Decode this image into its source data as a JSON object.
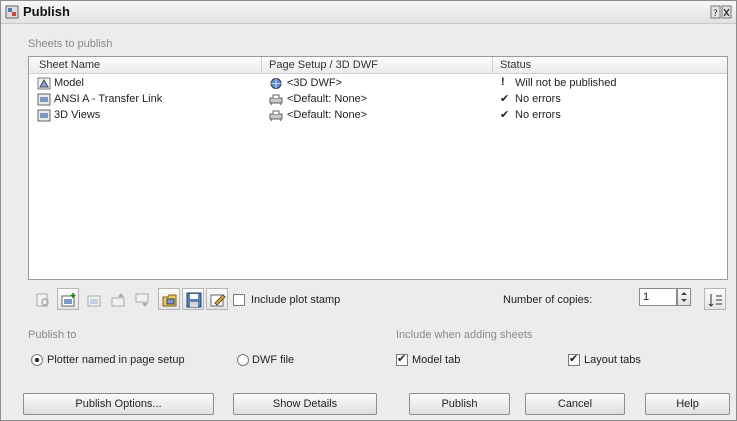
{
  "window": {
    "title": "Publish"
  },
  "sheets_group": {
    "label": "Sheets to publish"
  },
  "table": {
    "columns": [
      "Sheet Name",
      "Page Setup / 3D DWF",
      "Status"
    ],
    "rows": [
      {
        "sheet": "Model",
        "sheet_icon": "model-icon",
        "setup": "<3D DWF>",
        "setup_icon": "globe-icon",
        "status": "Will not be published",
        "status_icon": "exclamation-icon"
      },
      {
        "sheet": "ANSI A - Transfer Link",
        "sheet_icon": "layout-icon",
        "setup": "<Default: None>",
        "setup_icon": "plotter-icon",
        "status": "No errors",
        "status_icon": "checkmark-icon"
      },
      {
        "sheet": "3D Views",
        "sheet_icon": "layout-icon",
        "setup": "<Default: None>",
        "setup_icon": "plotter-icon",
        "status": "No errors",
        "status_icon": "checkmark-icon"
      }
    ]
  },
  "toolbar": {
    "include_plot_stamp": "Include plot stamp",
    "include_plot_stamp_checked": false,
    "copies_label": "Number of copies:",
    "copies_value": "1"
  },
  "publish_to": {
    "label": "Publish to",
    "option_plotter": "Plotter named in page setup",
    "option_dwf": "DWF file",
    "selected": "plotter"
  },
  "include_sheets": {
    "label": "Include when adding sheets",
    "model_tab": "Model tab",
    "model_tab_checked": true,
    "layout_tabs": "Layout tabs",
    "layout_tabs_checked": true
  },
  "buttons": {
    "publish_options": "Publish Options...",
    "show_details": "Show Details",
    "publish": "Publish",
    "cancel": "Cancel",
    "help": "Help"
  }
}
